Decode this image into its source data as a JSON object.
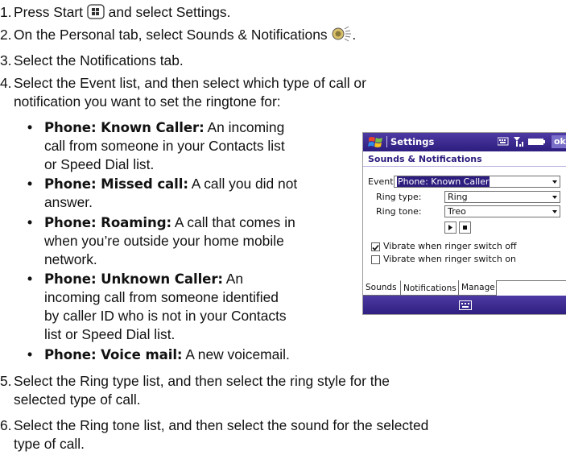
{
  "steps": [
    {
      "num": "1.",
      "before": "Press Start ",
      "icon": "start-button-icon",
      "after": " and select Settings."
    },
    {
      "num": "2.",
      "before": "On the Personal tab, select Sounds & Notifications ",
      "icon": "speaker-icon",
      "after": "."
    },
    {
      "num": "3.",
      "text": "Select the Notifications tab."
    },
    {
      "num": "4.",
      "line1": "Select the Event list, and then select which type of call or",
      "line2": "notification you want to set the ringtone for:"
    },
    {
      "num": "5.",
      "line1": "Select the Ring type list, and then select the ring style for the",
      "line2": "selected type of call."
    },
    {
      "num": "6.",
      "line1": "Select the Ring tone list, and then select the sound for the selected",
      "line2": "type of call."
    }
  ],
  "bullets": [
    {
      "term": "Phone: Known Caller:",
      "lines": [
        " An incoming",
        "call from someone in your Contacts list",
        "or Speed Dial list."
      ]
    },
    {
      "term": "Phone: Missed call:",
      "lines": [
        " A call you did not",
        "answer."
      ]
    },
    {
      "term": "Phone: Roaming:",
      "lines": [
        " A call that comes in",
        "when you’re outside your home mobile",
        "network."
      ]
    },
    {
      "term": "Phone: Unknown Caller:",
      "lines": [
        " An",
        "incoming call from someone identified",
        "by caller ID who is not in your Contacts",
        "list or Speed Dial list."
      ]
    },
    {
      "term": "Phone: Voice mail:",
      "lines": [
        " A new voicemail."
      ]
    }
  ],
  "bullet_char": "•",
  "device": {
    "title": "Settings",
    "ok": "ok",
    "status_icons": [
      "keyboard-status-icon",
      "signal-icon",
      "battery-icon"
    ],
    "subheader": "Sounds & Notifications",
    "event_label": "Event:",
    "event_value": "Phone: Known Caller",
    "ring_type_label": "Ring type:",
    "ring_type_value": "Ring",
    "ring_tone_label": "Ring tone:",
    "ring_tone_value": "Treo",
    "checkboxes": [
      {
        "label": "Vibrate when ringer switch off",
        "checked": true
      },
      {
        "label": "Vibrate when ringer switch on",
        "checked": false
      }
    ],
    "tabs": [
      "Sounds",
      "Notifications",
      "Manage"
    ],
    "active_tab": "Notifications",
    "accent": "#2d1d7e"
  }
}
